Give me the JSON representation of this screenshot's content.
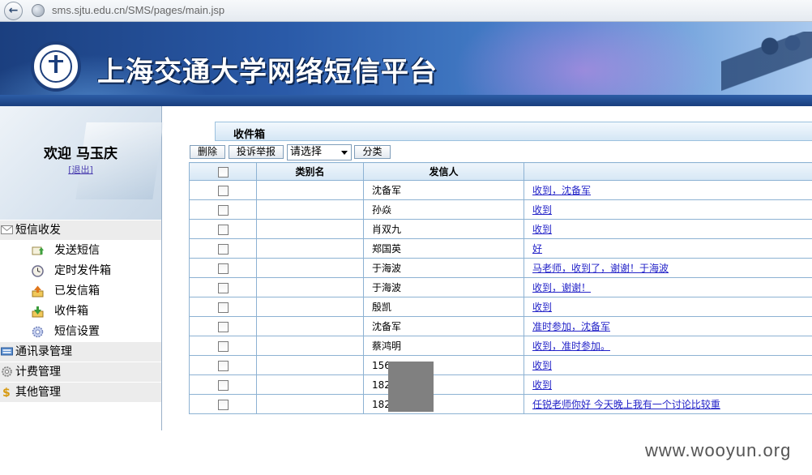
{
  "browser": {
    "url": "sms.sjtu.edu.cn/SMS/pages/main.jsp"
  },
  "banner": {
    "title": "上海交通大学网络短信平台"
  },
  "sidebar": {
    "welcome": "欢迎 马玉庆",
    "logout": "[退出]",
    "groups": [
      {
        "label": "短信收发",
        "icon": "envelope-icon",
        "items": [
          {
            "label": "发送短信",
            "icon": "send-message-icon"
          },
          {
            "label": "定时发件箱",
            "icon": "clock-icon"
          },
          {
            "label": "已发信箱",
            "icon": "outbox-icon"
          },
          {
            "label": "收件箱",
            "icon": "inbox-icon"
          },
          {
            "label": "短信设置",
            "icon": "gear-icon"
          }
        ]
      },
      {
        "label": "通讯录管理",
        "icon": "address-book-icon"
      },
      {
        "label": "计费管理",
        "icon": "billing-gear-icon"
      },
      {
        "label": "其他管理",
        "icon": "dollar-icon"
      }
    ]
  },
  "main": {
    "section_title": "收件箱",
    "toolbar": {
      "delete": "删除",
      "report": "投诉举报",
      "select_value": "请选择",
      "classify": "分类"
    },
    "columns": [
      "",
      "类别名",
      "发信人",
      ""
    ],
    "rows": [
      {
        "category": "",
        "sender": "沈备军",
        "message": "收到，沈备军"
      },
      {
        "category": "",
        "sender": "孙焱",
        "message": "收到"
      },
      {
        "category": "",
        "sender": "肖双九",
        "message": "收到"
      },
      {
        "category": "",
        "sender": "郑国英",
        "message": "好"
      },
      {
        "category": "",
        "sender": "于海波",
        "message": "马老师，收到了，谢谢！于海波"
      },
      {
        "category": "",
        "sender": "于海波",
        "message": "收到，谢谢！"
      },
      {
        "category": "",
        "sender": "殷凯",
        "message": "收到"
      },
      {
        "category": "",
        "sender": "沈备军",
        "message": "准时参加，沈备军"
      },
      {
        "category": "",
        "sender": "蔡鸿明",
        "message": "收到，准时参加。"
      },
      {
        "category": "",
        "sender": "156",
        "message": "收到"
      },
      {
        "category": "",
        "sender": "182",
        "message": "收到"
      },
      {
        "category": "",
        "sender": "182",
        "message": "任锐老师你好 今天晚上我有一个讨论比较重"
      }
    ]
  },
  "watermark": "www.wooyun.org"
}
